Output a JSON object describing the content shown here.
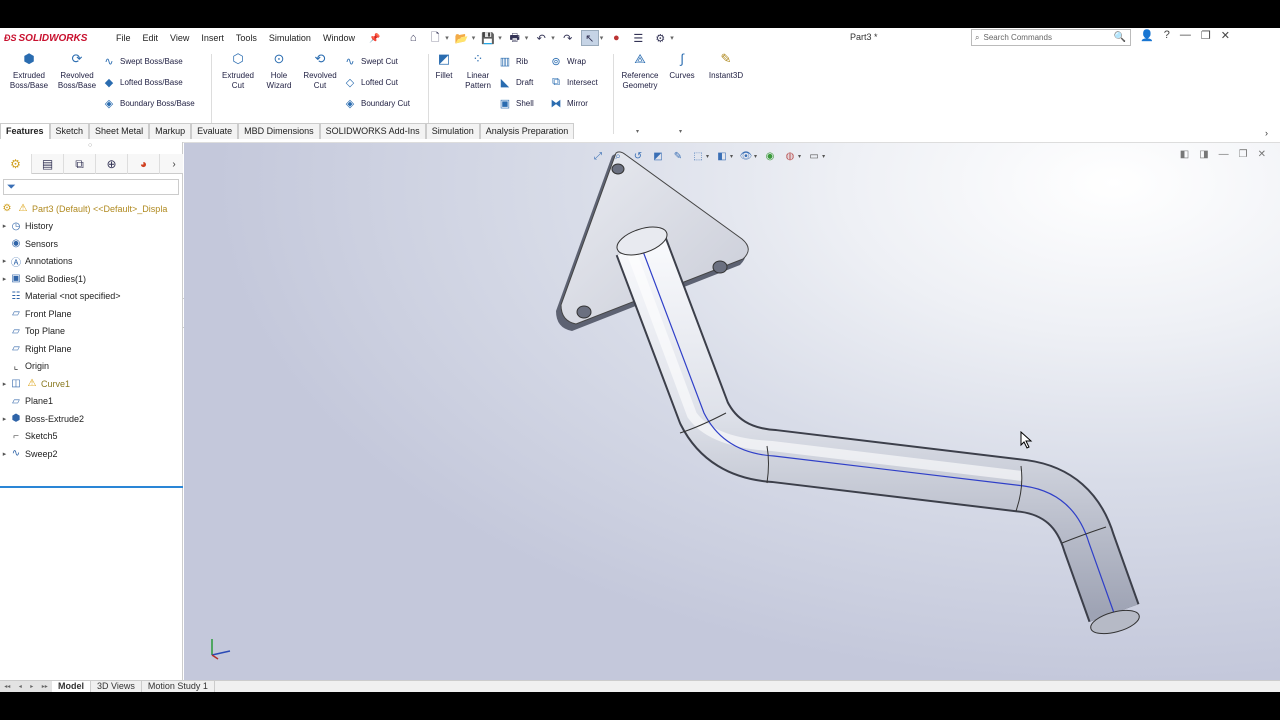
{
  "app": {
    "name": "SOLIDWORKS",
    "document_title": "Part3 *"
  },
  "menu": [
    "File",
    "Edit",
    "View",
    "Insert",
    "Tools",
    "Simulation",
    "Window"
  ],
  "search": {
    "placeholder": "Search Commands"
  },
  "ribbon": {
    "extruded_boss": "Extruded\nBoss/Base",
    "revolved_boss": "Revolved\nBoss/Base",
    "swept_boss": "Swept Boss/Base",
    "lofted_boss": "Lofted Boss/Base",
    "boundary_boss": "Boundary Boss/Base",
    "extruded_cut": "Extruded\nCut",
    "hole_wizard": "Hole\nWizard",
    "revolved_cut": "Revolved\nCut",
    "swept_cut": "Swept Cut",
    "lofted_cut": "Lofted Cut",
    "boundary_cut": "Boundary Cut",
    "fillet": "Fillet",
    "linear_pattern": "Linear\nPattern",
    "rib": "Rib",
    "draft": "Draft",
    "shell": "Shell",
    "wrap": "Wrap",
    "intersect": "Intersect",
    "mirror": "Mirror",
    "reference_geometry": "Reference\nGeometry",
    "curves": "Curves",
    "instant3d": "Instant3D"
  },
  "tabs": [
    "Features",
    "Sketch",
    "Sheet Metal",
    "Markup",
    "Evaluate",
    "MBD Dimensions",
    "SOLIDWORKS Add-Ins",
    "Simulation",
    "Analysis Preparation"
  ],
  "active_tab": "Features",
  "tree": {
    "root": "Part3 (Default) <<Default>_Displa",
    "items": [
      {
        "label": "History",
        "icon": "history-icon",
        "expandable": true
      },
      {
        "label": "Sensors",
        "icon": "sensors-icon",
        "expandable": false
      },
      {
        "label": "Annotations",
        "icon": "annotations-icon",
        "expandable": true
      },
      {
        "label": "Solid Bodies(1)",
        "icon": "solid-bodies-icon",
        "expandable": true
      },
      {
        "label": "Material <not specified>",
        "icon": "material-icon",
        "expandable": false
      },
      {
        "label": "Front Plane",
        "icon": "plane-icon",
        "expandable": false
      },
      {
        "label": "Top Plane",
        "icon": "plane-icon",
        "expandable": false
      },
      {
        "label": "Right Plane",
        "icon": "plane-icon",
        "expandable": false
      },
      {
        "label": "Origin",
        "icon": "origin-icon",
        "expandable": false
      },
      {
        "label": "Curve1",
        "icon": "curve-icon",
        "expandable": true
      },
      {
        "label": "Plane1",
        "icon": "plane-icon",
        "expandable": false
      },
      {
        "label": "Boss-Extrude2",
        "icon": "extrude-icon",
        "expandable": true
      },
      {
        "label": "Sketch5",
        "icon": "sketch-icon",
        "expandable": false
      },
      {
        "label": "Sweep2",
        "icon": "sweep-icon",
        "expandable": true
      }
    ]
  },
  "bottom_tabs": [
    "Model",
    "3D Views",
    "Motion Study 1"
  ],
  "active_bottom_tab": "Model",
  "colors": {
    "accent": "#2a6cb0",
    "brand": "#c8102e",
    "warning": "#d89a00",
    "path_line": "#2f3fc8"
  }
}
